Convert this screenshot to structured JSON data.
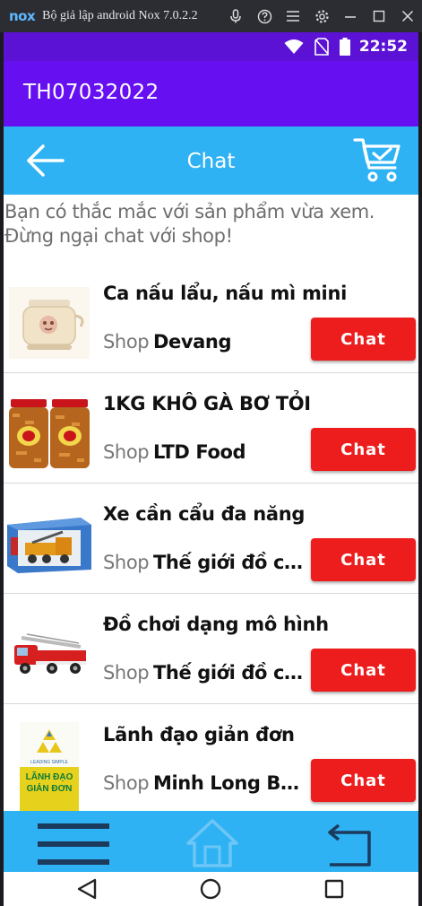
{
  "emulator": {
    "logo": "nox",
    "title": "Bộ giả lập android Nox 7.0.2.2",
    "icons": [
      "microphone-icon",
      "help-icon",
      "menu-icon",
      "settings-icon",
      "minimize-icon",
      "maximize-icon",
      "close-icon"
    ]
  },
  "statusbar": {
    "time": "22:52",
    "icons": [
      "wifi-icon",
      "no-sim-icon",
      "battery-icon"
    ]
  },
  "app": {
    "title": "TH07032022",
    "accent": "#6610f2"
  },
  "toolbar": {
    "title": "Chat",
    "back_icon": "arrow-left-icon",
    "cart_icon": "cart-check-icon",
    "color": "#2fb2f3"
  },
  "intro": "Bạn có thắc mắc với sản phẩm vừa xem. Đừng ngại chat với shop!",
  "shop_prefix": "Shop",
  "items": [
    {
      "name": "Ca nấu lẩu, nấu mì mini",
      "shop": "Devang",
      "chat": "Chat",
      "thumb": "cooker-image"
    },
    {
      "name": "1KG KHÔ GÀ BƠ TỎI",
      "shop": "LTD Food",
      "chat": "Chat",
      "thumb": "dried-chicken-jars-image"
    },
    {
      "name": "Xe cần cẩu đa năng",
      "shop": "Thế giới đồ chơi",
      "chat": "Chat",
      "thumb": "crane-truck-box-image"
    },
    {
      "name": "Đồ chơi dạng mô hình",
      "shop": "Thế giới đồ chơi",
      "chat": "Chat",
      "thumb": "fire-truck-image"
    },
    {
      "name": "Lãnh đạo giản đơn",
      "shop": "Minh Long Book",
      "chat": "Chat",
      "thumb": "book-cover-image"
    }
  ],
  "book_cover": {
    "line1": "LEADING SIMPLE",
    "line2": "LÃNH ĐẠO",
    "line3": "GIẢN ĐƠN"
  },
  "bottomnav": {
    "icons": [
      "menu-icon",
      "home-icon",
      "return-icon"
    ]
  },
  "sysnav": {
    "icons": [
      "back-triangle-icon",
      "home-circle-icon",
      "recents-square-icon"
    ]
  },
  "colors": {
    "chat_button": "#ee1d1d",
    "status_bar": "#5b12d4"
  }
}
